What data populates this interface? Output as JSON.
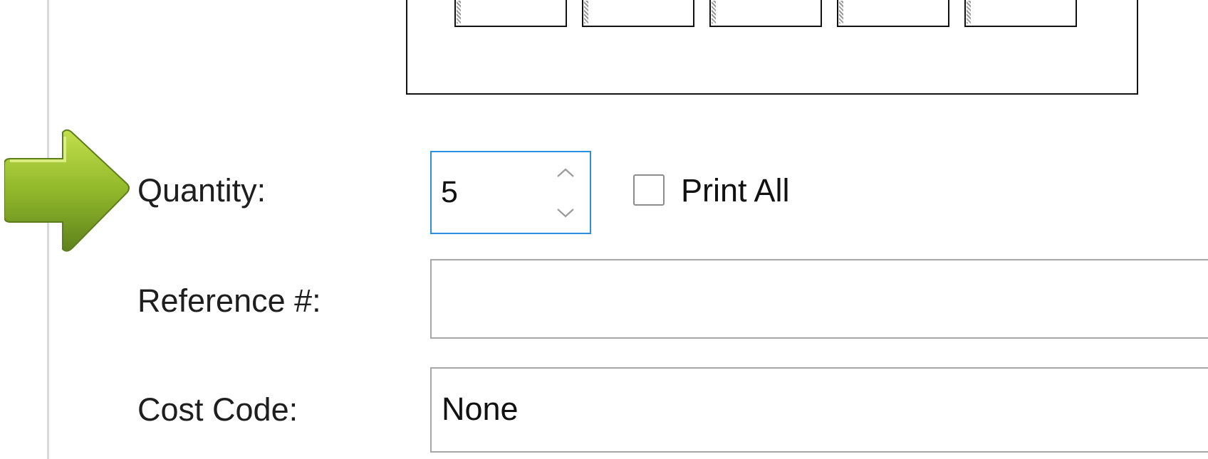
{
  "form": {
    "quantity": {
      "label": "Quantity:",
      "value": "5"
    },
    "print_all": {
      "label": "Print All",
      "checked": false
    },
    "reference": {
      "label": "Reference #:",
      "value": ""
    },
    "cost_code": {
      "label": "Cost Code:",
      "value": "None"
    }
  },
  "callout": {
    "icon": "green-arrow-right",
    "color": "#8CB82B"
  },
  "theme": {
    "focus_color": "#2B8FE0"
  }
}
